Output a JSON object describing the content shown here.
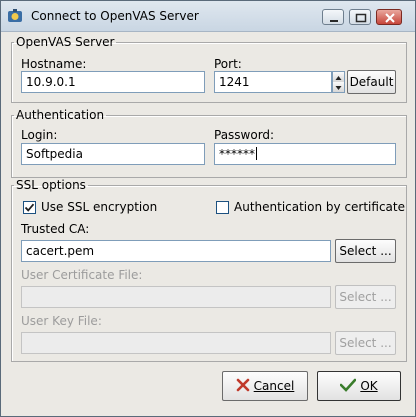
{
  "window": {
    "title": "Connect to OpenVAS Server",
    "minimize_icon": "minimize-icon",
    "maximize_icon": "maximize-icon",
    "close_icon": "close-icon"
  },
  "server": {
    "legend": "OpenVAS Server",
    "hostname_label": "Hostname:",
    "hostname_value": "10.9.0.1",
    "port_label": "Port:",
    "port_value": "1241",
    "default_button": "Default"
  },
  "auth": {
    "legend": "Authentication",
    "login_label": "Login:",
    "login_value": "Softpedia",
    "password_label": "Password:",
    "password_value": "******"
  },
  "ssl": {
    "legend": "SSL options",
    "use_ssl_label": "Use SSL encryption",
    "use_ssl_checked": true,
    "auth_cert_label": "Authentication by certificate",
    "auth_cert_checked": false,
    "trusted_ca_label": "Trusted CA:",
    "trusted_ca_value": "cacert.pem",
    "select_label": "Select ...",
    "user_cert_label": "User Certificate File:",
    "user_cert_value": "",
    "user_key_label": "User Key File:",
    "user_key_value": ""
  },
  "actions": {
    "cancel_label": "Cancel",
    "ok_label": "OK"
  },
  "colors": {
    "window_bg": "#ebe9e4",
    "input_border": "#7f9db9",
    "cancel_icon": "#c0392b",
    "ok_icon": "#3a7d2c"
  }
}
